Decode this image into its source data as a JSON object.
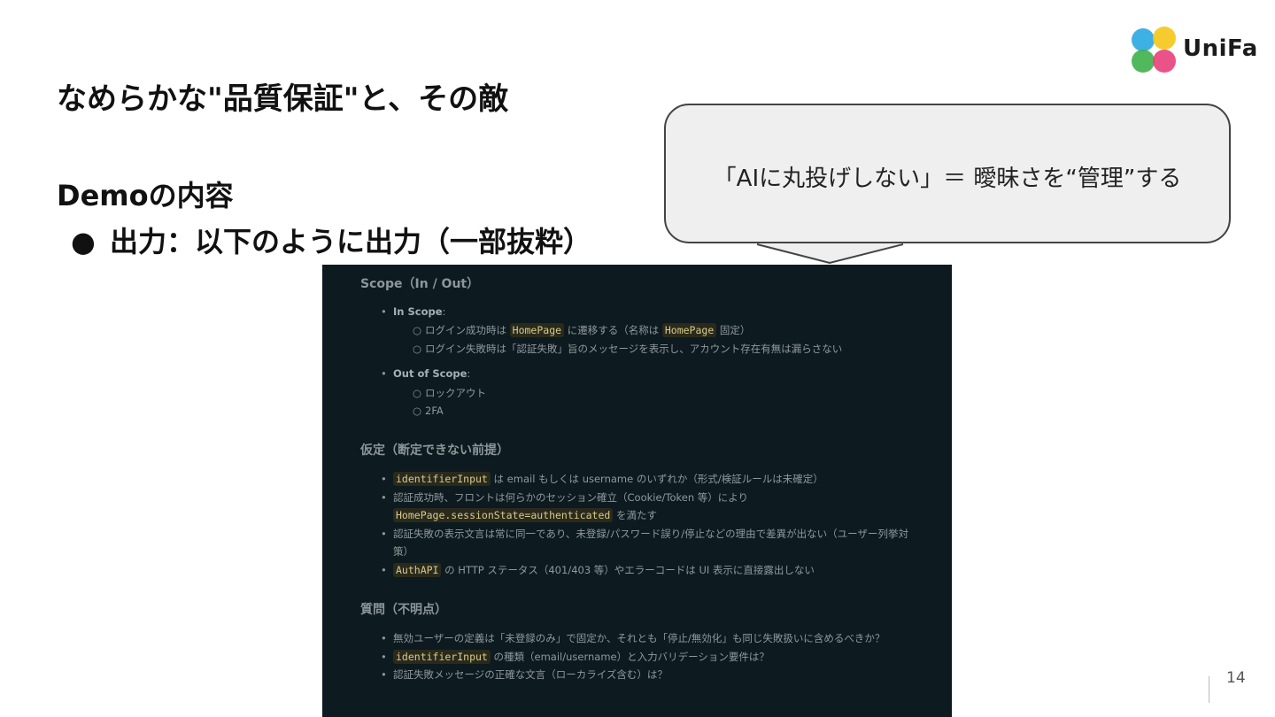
{
  "logo": {
    "text": "UniFa",
    "colors": [
      "#2aa7e0",
      "#f5c518",
      "#3fb04a",
      "#e8407a"
    ]
  },
  "title": "なめらかな\"品質保証\"と、その敵",
  "section_heading": "Demoの内容",
  "bullet": {
    "marker": "●",
    "text": "出力：以下のように出力（一部抜粋）"
  },
  "callout": {
    "text": "「AIに丸投げしない」＝ 曖昧さを“管理”する"
  },
  "screenshot": {
    "scope": {
      "heading": "Scope（In / Out）",
      "in_label": "In Scope",
      "in_items": [
        {
          "pre": "ログイン成功時は",
          "code1": "HomePage",
          "mid": "に遷移する（名称は",
          "code2": "HomePage",
          "post": "固定）"
        },
        {
          "text": "ログイン失敗時は「認証失敗」旨のメッセージを表示し、アカウント存在有無は漏らさない"
        }
      ],
      "out_label": "Out of Scope",
      "out_items": [
        "ロックアウト",
        "2FA"
      ]
    },
    "assumptions": {
      "heading": "仮定（断定できない前提）",
      "item1": {
        "code": "identifierInput",
        "text": "は email もしくは username のいずれか（形式/検証ルールは未確定）"
      },
      "item2": {
        "text": "認証成功時、フロントは何らかのセッション確立（Cookie/Token 等）により",
        "code": "HomePage.sessionState=authenticated",
        "post": "を満たす"
      },
      "item3": {
        "line1": "認証失敗の表示文言は常に同一であり、未登録/パスワード誤り/停止などの理由で差異が出ない（ユーザー列挙対",
        "line2": "策）"
      },
      "item4": {
        "code": "AuthAPI",
        "text": "の HTTP ステータス（401/403 等）やエラーコードは UI 表示に直接露出しない"
      }
    },
    "questions": {
      "heading": "質問（不明点）",
      "item1": {
        "text": "無効ユーザーの定義は「未登録のみ」で固定か、それとも「停止/無効化」も同じ失敗扱いに含めるべきか？"
      },
      "item2": {
        "code": "identifierInput",
        "text": "の種類（email/username）と入力バリデーション要件は？"
      },
      "item3": {
        "text": "認証失敗メッセージの正確な文言（ローカライズ含む）は？"
      }
    }
  },
  "page_number": "14"
}
